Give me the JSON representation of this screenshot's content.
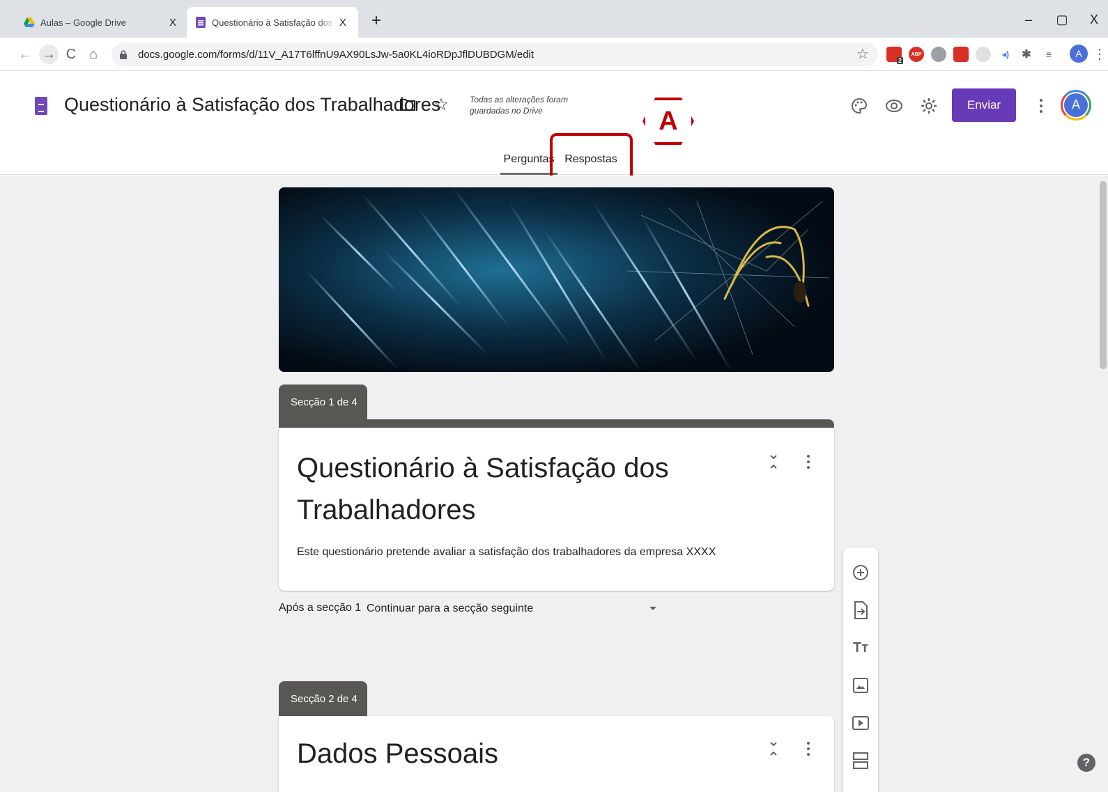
{
  "browser": {
    "tabs": [
      {
        "title": "Aulas – Google Drive",
        "close": "X"
      },
      {
        "title": "Questionário à Satisfação dos Trabalhadores",
        "close": "X"
      }
    ],
    "new_tab": "+",
    "window_controls": {
      "minimize": "–",
      "restore": "▢",
      "close": "X"
    },
    "url": "docs.google.com/forms/d/11V_A17T6lffnU9AX90LsJw-5a0KL4ioRDpJflDUBDGM/edit",
    "extension_badge": "2",
    "extension_abp": "ABP",
    "profile_initial": "A"
  },
  "forms": {
    "title": "Questionário à Satisfação dos Trabalhadores",
    "saved_line1": "Todas as alterações foram",
    "saved_line2": "guardadas no Drive",
    "send_label": "Enviar",
    "profile_initial": "A",
    "tabs": {
      "questions": "Perguntas",
      "responses": "Respostas"
    },
    "marker_label": "A"
  },
  "sections": [
    {
      "tab_label": "Secção 1 de 4",
      "title": "Questionário à Satisfação dos Trabalhadores",
      "description": "Este questionário pretende avaliar a satisfação dos trabalhadores da empresa XXXX"
    },
    {
      "tab_label": "Secção 2 de 4",
      "title": "Dados Pessoais"
    }
  ],
  "after_section": {
    "label": "Após a secção 1",
    "value": "Continuar para a secção seguinte"
  },
  "side_toolbar": [
    "add-question-icon",
    "import-questions-icon",
    "add-title-icon",
    "add-image-icon",
    "add-video-icon",
    "add-section-icon"
  ],
  "help": "?",
  "colors": {
    "accent": "#673ab7",
    "section_tab": "#595754",
    "highlight": "#c00000"
  }
}
